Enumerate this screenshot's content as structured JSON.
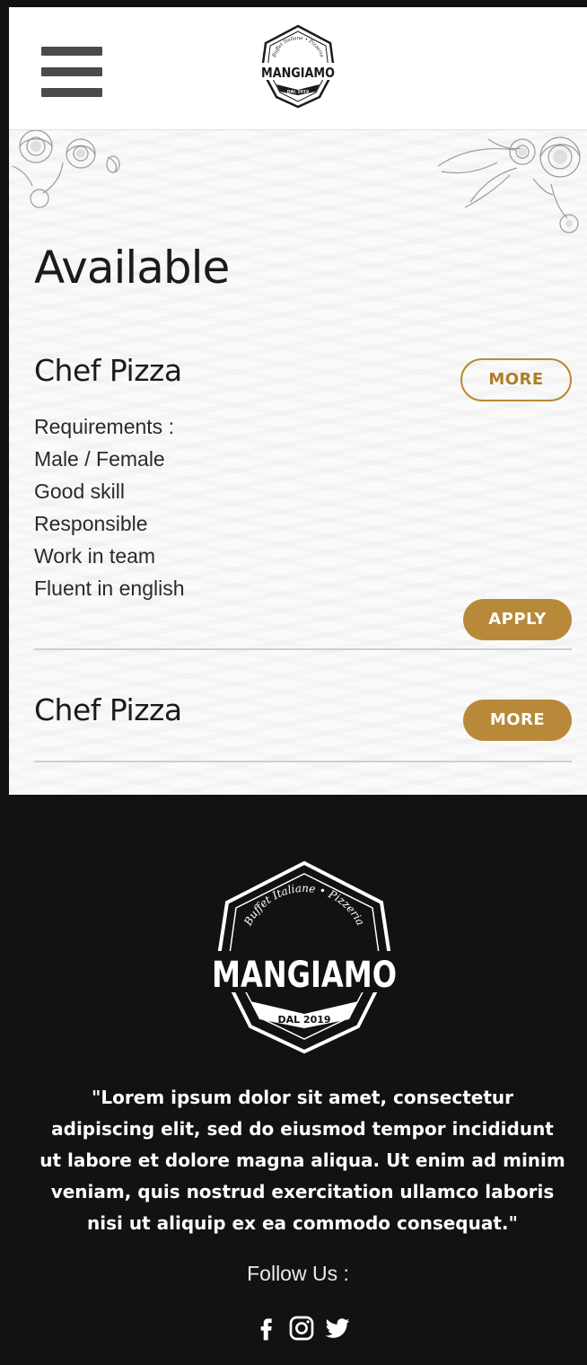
{
  "header": {
    "logo": {
      "brand": "MANGIAMO",
      "tagline": "Buffet Italiane • Pizzeria",
      "since": "DAL 2019"
    },
    "menu_icon": "hamburger-icon"
  },
  "main": {
    "section_title": "Available",
    "jobs": [
      {
        "title": "Chef Pizza",
        "more_label": "MORE",
        "requirements": [
          "Requirements :",
          "Male / Female",
          "Good skill",
          "Responsible",
          "Work in team",
          "Fluent in english"
        ],
        "apply_label": "APPLY"
      },
      {
        "title": "Chef Pizza",
        "more_label": "MORE"
      }
    ]
  },
  "footer": {
    "logo": {
      "brand": "MANGIAMO",
      "tagline": "Buffet Italiane • Pizzeria",
      "since": "DAL 2019"
    },
    "quote": "\"Lorem ipsum dolor sit amet, consectetur adipiscing elit, sed do eiusmod tempor incididunt ut labore et dolore magna aliqua. Ut enim ad minim veniam, quis nostrud exercitation ullamco laboris nisi ut aliquip ex ea commodo consequat.\"",
    "follow_label": "Follow Us :",
    "social": [
      "facebook-icon",
      "instagram-icon",
      "twitter-icon"
    ]
  },
  "colors": {
    "accent": "#b9893a",
    "footer_bg": "#121212",
    "text": "#1b1b1b"
  }
}
